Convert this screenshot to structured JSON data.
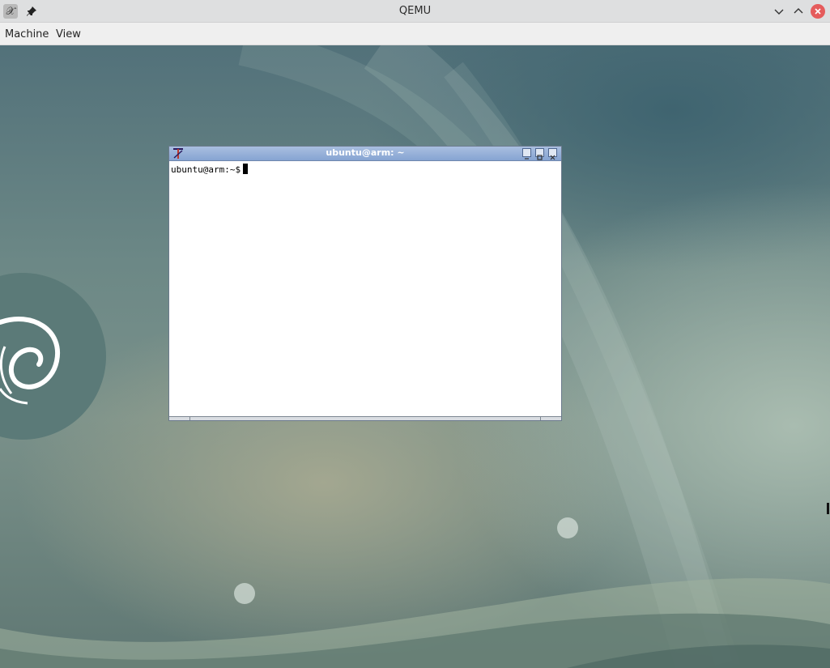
{
  "host_window": {
    "title": "QEMU",
    "app_icon": "qemu-app-icon",
    "buttons": [
      "pin-icon",
      "minimize-chevron-icon",
      "maximize-chevron-icon",
      "close-icon"
    ]
  },
  "menubar": {
    "items": [
      {
        "label": "Machine"
      },
      {
        "label": "View"
      }
    ]
  },
  "guest": {
    "desktop": {
      "wallpaper": "debian-swirl-wallpaper",
      "colors": {
        "accent": "#5e7b7f",
        "swirl_disc": "#5b7a78"
      }
    },
    "xterm": {
      "title": "ubuntu@arm: ~",
      "prompt": "ubuntu@arm:~$",
      "colors": {
        "titlebar": "#8fabd6",
        "title_text": "#ffffff"
      }
    }
  }
}
